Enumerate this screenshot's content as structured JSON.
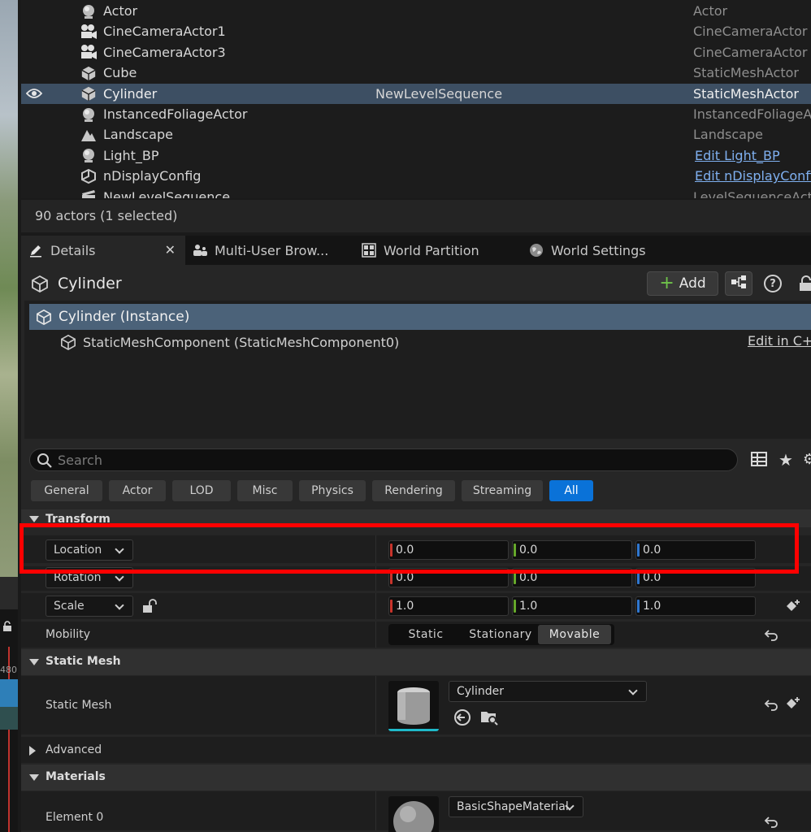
{
  "viewport": {
    "number_fragment": "480"
  },
  "outliner": {
    "rows": [
      {
        "name": "Actor",
        "sequence": "",
        "type": "Actor",
        "icon": "actor-icon",
        "selected": false,
        "link": false
      },
      {
        "name": "CineCameraActor1",
        "sequence": "",
        "type": "CineCameraActor",
        "icon": "camera-icon",
        "selected": false,
        "link": false
      },
      {
        "name": "CineCameraActor3",
        "sequence": "",
        "type": "CineCameraActor",
        "icon": "camera-icon",
        "selected": false,
        "link": false
      },
      {
        "name": "Cube",
        "sequence": "",
        "type": "StaticMeshActor",
        "icon": "static-mesh-icon",
        "selected": false,
        "link": false
      },
      {
        "name": "Cylinder",
        "sequence": "NewLevelSequence",
        "type": "StaticMeshActor",
        "icon": "static-mesh-icon",
        "selected": true,
        "link": false
      },
      {
        "name": "InstancedFoliageActor",
        "sequence": "",
        "type": "InstancedFoliageActor",
        "icon": "actor-icon",
        "selected": false,
        "link": false
      },
      {
        "name": "Landscape",
        "sequence": "",
        "type": "Landscape",
        "icon": "landscape-icon",
        "selected": false,
        "link": false
      },
      {
        "name": "Light_BP",
        "sequence": "",
        "type": "Edit Light_BP",
        "icon": "actor-icon",
        "selected": false,
        "link": true
      },
      {
        "name": "nDisplayConfig",
        "sequence": "",
        "type": "Edit nDisplayConfig",
        "icon": "ndisplay-icon",
        "selected": false,
        "link": true
      },
      {
        "name": "NewLevelSequence",
        "sequence": "",
        "type": "LevelSequenceActor",
        "icon": "sequence-icon",
        "selected": false,
        "link": false
      }
    ],
    "status": "90 actors (1 selected)"
  },
  "tabs": [
    {
      "label": "Details",
      "icon": "pencil-icon",
      "active": true
    },
    {
      "label": "Multi-User Brow...",
      "icon": "users-icon",
      "active": false
    },
    {
      "label": "World Partition",
      "icon": "grid-icon",
      "active": false
    },
    {
      "label": "World Settings",
      "icon": "globe-icon",
      "active": false
    }
  ],
  "details": {
    "title": "Cylinder",
    "add_label": "Add",
    "selected_component": "Cylinder (Instance)",
    "child_component": "StaticMeshComponent (StaticMeshComponent0)",
    "edit_cpp": "Edit in C++",
    "search_placeholder": "Search",
    "filters": [
      "General",
      "Actor",
      "LOD",
      "Misc",
      "Physics",
      "Rendering",
      "Streaming",
      "All"
    ],
    "active_filter": "All",
    "transform": {
      "header": "Transform",
      "location_label": "Location",
      "location": [
        "0.0",
        "0.0",
        "0.0"
      ],
      "rotation_label": "Rotation",
      "rotation": [
        "0.0",
        "0.0",
        "0.0"
      ],
      "scale_label": "Scale",
      "scale": [
        "1.0",
        "1.0",
        "1.0"
      ],
      "mobility_label": "Mobility",
      "mobility_options": [
        "Static",
        "Stationary",
        "Movable"
      ],
      "mobility_selected": "Movable"
    },
    "static_mesh": {
      "header": "Static Mesh",
      "label": "Static Mesh",
      "value": "Cylinder"
    },
    "advanced_label": "Advanced",
    "materials": {
      "header": "Materials",
      "element_label": "Element 0",
      "value": "BasicShapeMaterial"
    }
  },
  "colors": {
    "selected_row": "#3d4f63",
    "accent": "#0a72d8",
    "highlight": "#ff0000",
    "link": "#7fb0f0"
  }
}
